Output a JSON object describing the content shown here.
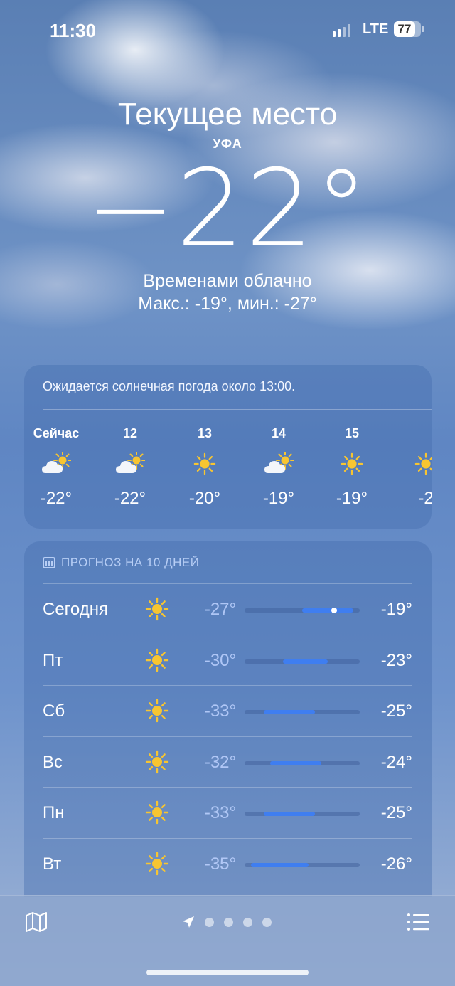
{
  "status": {
    "time": "11:30",
    "network": "LTE",
    "battery": "77"
  },
  "header": {
    "location": "Текущее место",
    "city": "УФА",
    "temperature": "−22°",
    "condition": "Временами облачно",
    "hilo": "Макс.: -19°, мин.: -27°"
  },
  "hourly": {
    "message": "Ожидается солнечная погода около 13:00.",
    "items": [
      {
        "label": "Сейчас",
        "icon": "partly-cloudy-icon",
        "temp": "-22°"
      },
      {
        "label": "12",
        "icon": "partly-cloudy-icon",
        "temp": "-22°"
      },
      {
        "label": "13",
        "icon": "sun-icon",
        "temp": "-20°"
      },
      {
        "label": "14",
        "icon": "partly-cloudy-icon",
        "temp": "-19°"
      },
      {
        "label": "15",
        "icon": "sun-icon",
        "temp": "-19°"
      },
      {
        "label": "",
        "icon": "sun-icon",
        "temp": "-2"
      }
    ]
  },
  "daily": {
    "title": "ПРОГНОЗ НА 10 ДНЕЙ",
    "range": [
      -36,
      -18
    ],
    "current_temp": -22,
    "items": [
      {
        "day": "Сегодня",
        "icon": "sun-icon",
        "low": "-27°",
        "high": "-19°",
        "low_v": -27,
        "high_v": -19
      },
      {
        "day": "Пт",
        "icon": "sun-icon",
        "low": "-30°",
        "high": "-23°",
        "low_v": -30,
        "high_v": -23
      },
      {
        "day": "Сб",
        "icon": "sun-icon",
        "low": "-33°",
        "high": "-25°",
        "low_v": -33,
        "high_v": -25
      },
      {
        "day": "Вс",
        "icon": "sun-icon",
        "low": "-32°",
        "high": "-24°",
        "low_v": -32,
        "high_v": -24
      },
      {
        "day": "Пн",
        "icon": "sun-icon",
        "low": "-33°",
        "high": "-25°",
        "low_v": -33,
        "high_v": -25
      },
      {
        "day": "Вт",
        "icon": "sun-icon",
        "low": "-35°",
        "high": "-26°",
        "low_v": -35,
        "high_v": -26
      }
    ]
  },
  "colors": {
    "bar_fill": "#3f7ef0",
    "sun": "#f7c531"
  }
}
